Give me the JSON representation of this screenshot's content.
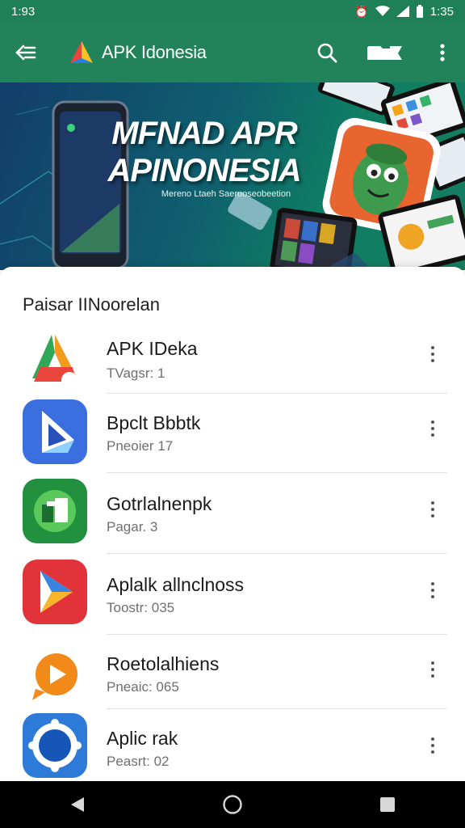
{
  "status_bar": {
    "time_left": "1:93",
    "battery_text": "",
    "time_right": "1:35"
  },
  "app_bar": {
    "title": "APK Idonesia",
    "icons": [
      "back-arrow-icon",
      "app-logo-icon",
      "search-icon",
      "folder-icon",
      "more-vert-icon"
    ]
  },
  "banner": {
    "title_line1": "MFNAD APR",
    "title_line2": "APINONESIA",
    "subtitle": "Mereno Ltaeh Saeruoseobeetion"
  },
  "section": {
    "title": "Paisar IINoorelan"
  },
  "apps": [
    {
      "name": "APK IDeka",
      "subtitle": "TVagsr: 1",
      "icon": "red-green-a-logo-icon"
    },
    {
      "name": "Bpclt Bbbtk",
      "subtitle": "Pneoier 17",
      "icon": "blue-triangle-logo-icon"
    },
    {
      "name": "Gotrlalnenpk",
      "subtitle": "Pagar. 3",
      "icon": "green-circle-logo-icon"
    },
    {
      "name": "Aplalk allnclnoss",
      "subtitle": "Toostr: 035",
      "icon": "red-play-logo-icon"
    },
    {
      "name": "Roetolalhiens",
      "subtitle": "Pneaic: 065",
      "icon": "orange-play-bubble-icon"
    },
    {
      "name": "Aplic rak",
      "subtitle": "Peasrt: 02",
      "icon": "blue-gear-logo-icon"
    }
  ],
  "nav_bar": {
    "icons": [
      "back-triangle-icon",
      "home-circle-icon",
      "recents-square-icon"
    ]
  },
  "colors": {
    "app_bar": "#22825a",
    "status_bar": "#1f7f56",
    "banner_start": "#123d6b",
    "banner_end": "#167d5e"
  }
}
